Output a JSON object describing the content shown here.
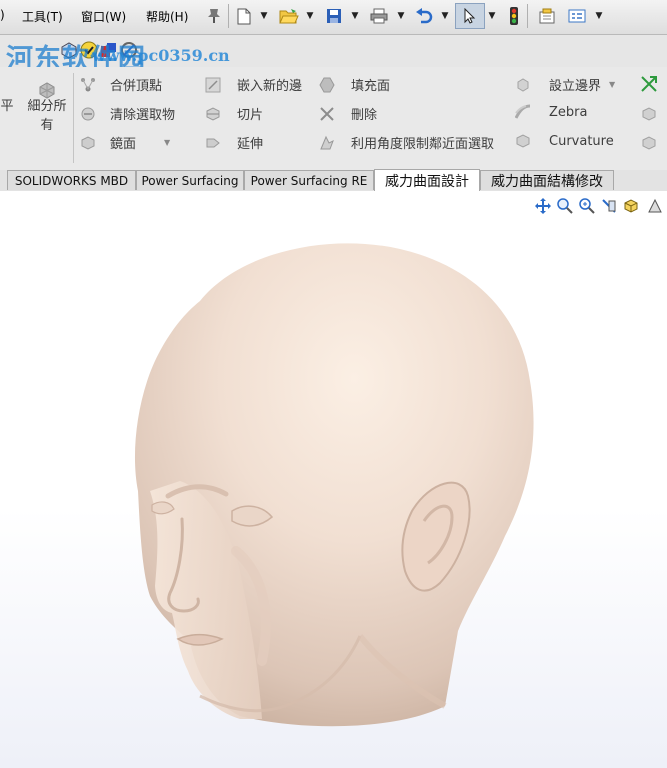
{
  "menu": {
    "partial_left": ")",
    "tools": "工具(T)",
    "window": "窗口(W)",
    "help": "帮助(H)"
  },
  "watermark": {
    "text": "河东软件园",
    "url": "www.pc0359.cn"
  },
  "ribbon": {
    "partial_left_label": "平",
    "subdivide_all": "細分所有",
    "merge_vertices": "合併頂點",
    "clear_selection": "清除選取物",
    "mirror": "鏡面",
    "insert_new_edge": "嵌入新的邊",
    "slice": "切片",
    "extend": "延伸",
    "fill_face": "填充面",
    "delete": "刪除",
    "angle_select": "利用角度限制鄰近面選取",
    "set_boundary": "設立邊界",
    "zebra": "Zebra",
    "curvature": "Curvature"
  },
  "tabs": [
    {
      "label": "SOLIDWORKS MBD",
      "active": false
    },
    {
      "label": "Power Surfacing",
      "active": false
    },
    {
      "label": "Power Surfacing RE",
      "active": false
    },
    {
      "label": "威力曲面設計",
      "active": true
    },
    {
      "label": "威力曲面結構修改",
      "active": false
    }
  ],
  "colors": {
    "model_skin": "#f1dfd2",
    "model_shadow": "#d9c0b0",
    "accent_blue": "#1f7fcf"
  }
}
